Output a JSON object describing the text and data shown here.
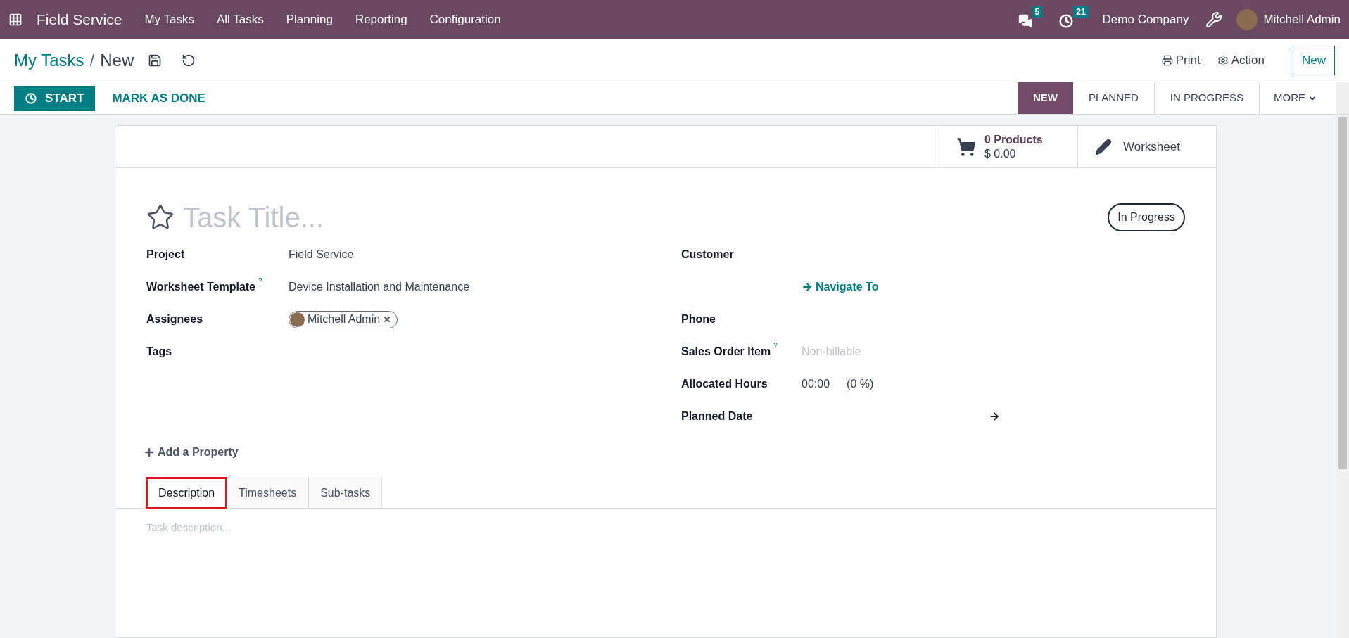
{
  "navbar": {
    "app_name": "Field Service",
    "menu": [
      "My Tasks",
      "All Tasks",
      "Planning",
      "Reporting",
      "Configuration"
    ],
    "messages_count": "5",
    "activities_count": "21",
    "company": "Demo Company",
    "user": "Mitchell Admin"
  },
  "control_panel": {
    "breadcrumb": "My Tasks",
    "separator": "/",
    "current": "New",
    "print": "Print",
    "action": "Action",
    "new_button": "New"
  },
  "status_bar": {
    "buttons": [
      {
        "label": "START",
        "kind": "primary"
      },
      {
        "label": "MARK AS DONE",
        "kind": "link"
      }
    ],
    "stages": [
      {
        "label": "NEW",
        "selected": true
      },
      {
        "label": "PLANNED",
        "selected": false
      },
      {
        "label": "IN PROGRESS",
        "selected": false
      }
    ],
    "more": "MORE"
  },
  "smart_buttons": [
    {
      "kind": "products",
      "title": "0 Products",
      "value": "$ 0.00"
    },
    {
      "kind": "worksheet",
      "title": "Worksheet"
    }
  ],
  "form": {
    "starred": false,
    "title_placeholder": "Task Title...",
    "state_badge": "In Progress",
    "left_fields": [
      {
        "label": "Project",
        "value": "Field Service",
        "kind": "text"
      },
      {
        "label": "Worksheet Template",
        "help": "?",
        "value": "Device Installation and Maintenance",
        "kind": "text"
      },
      {
        "label": "Assignees",
        "value": "Mitchell Admin",
        "kind": "tag"
      },
      {
        "label": "Tags",
        "kind": "text"
      }
    ],
    "right_fields": [
      {
        "label": "Customer",
        "kind": "text"
      },
      {
        "value": "Navigate To",
        "kind": "link"
      },
      {
        "label": "Phone",
        "kind": "text"
      },
      {
        "label": "Sales Order Item",
        "help": "?",
        "placeholder": "Non-billable",
        "kind": "placeholder"
      },
      {
        "label": "Allocated Hours",
        "value": "00:00",
        "extra": "(0 %)",
        "kind": "hours"
      },
      {
        "label": "Planned Date",
        "kind": "daterange"
      }
    ],
    "add_property": "Add a Property"
  },
  "tabs": [
    {
      "label": "Description",
      "selected": true,
      "highlighted": true
    },
    {
      "label": "Timesheets",
      "selected": false,
      "highlighted": false
    },
    {
      "label": "Sub-tasks",
      "selected": false,
      "highlighted": false
    }
  ],
  "description": {
    "placeholder": "Task description..."
  }
}
